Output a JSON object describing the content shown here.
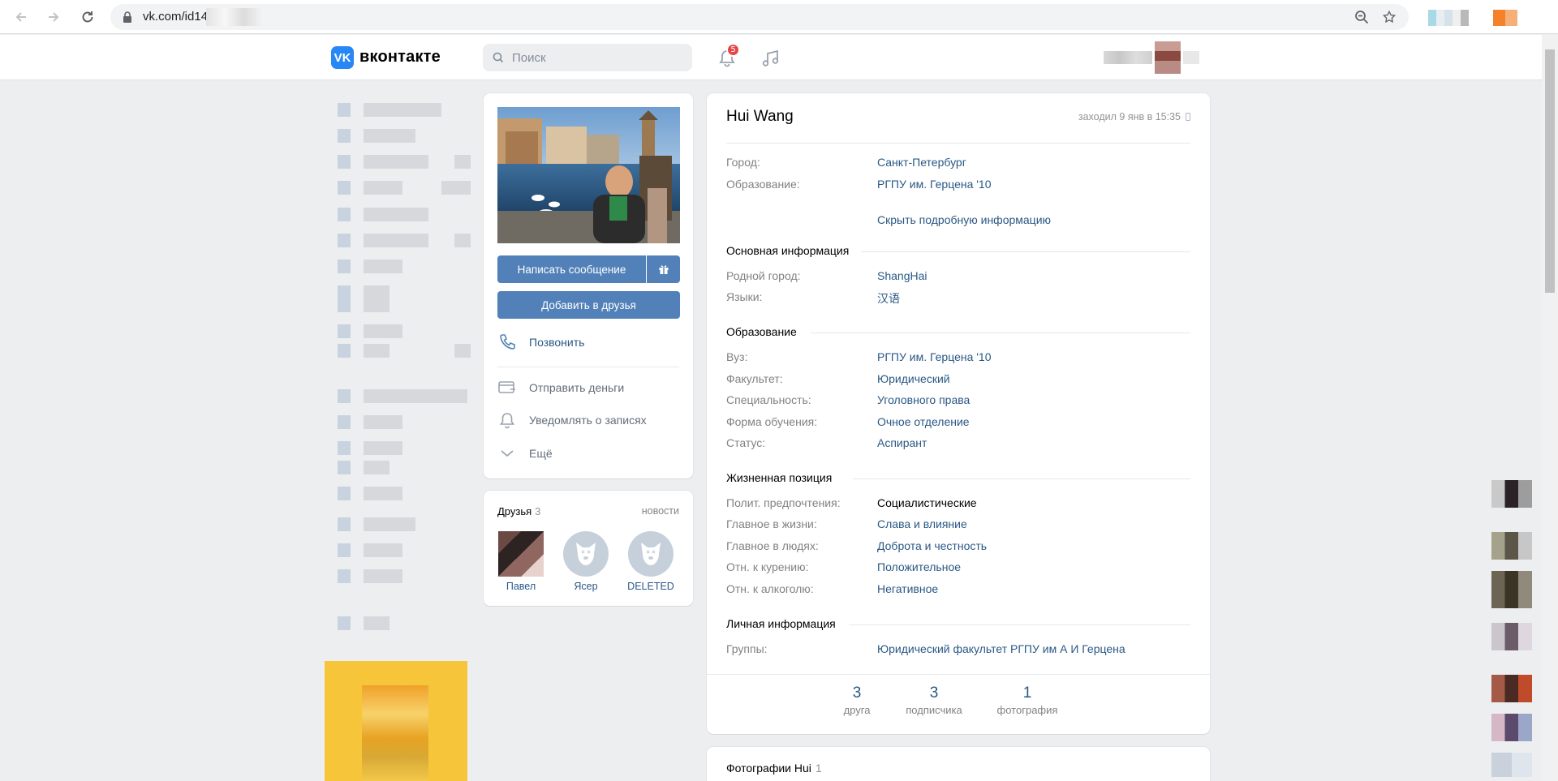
{
  "browser": {
    "url": "vk.com/id14",
    "back_icon": "arrow-left-icon",
    "forward_icon": "arrow-right-icon",
    "reload_icon": "reload-icon",
    "zoom_icon": "zoom-icon",
    "star_icon": "star-icon"
  },
  "header": {
    "logo_text": "вконтакте",
    "search_placeholder": "Поиск",
    "notification_count": "5"
  },
  "profile": {
    "name": "Hui Wang",
    "last_seen": "заходил 9 янв в 15:35",
    "buttons": {
      "message": "Написать сообщение",
      "add_friend": "Добавить в друзья"
    },
    "actions": {
      "call": "Позвонить",
      "send_money": "Отправить деньги",
      "notify": "Уведомлять о записях",
      "more": "Ещё"
    },
    "short_info": [
      {
        "key": "Город:",
        "value": "Санкт-Петербург"
      },
      {
        "key": "Образование:",
        "value": "РГПУ им. Герцена '10"
      }
    ],
    "toggle_details": "Скрыть подробную информацию",
    "sections": {
      "main": {
        "title": "Основная информация",
        "rows": [
          {
            "key": "Родной город:",
            "value": "ShangHai"
          },
          {
            "key": "Языки:",
            "value": "汉语"
          }
        ]
      },
      "education": {
        "title": "Образование",
        "rows": [
          {
            "key": "Вуз:",
            "value": "РГПУ им. Герцена '10"
          },
          {
            "key": "Факультет:",
            "value": "Юридический"
          },
          {
            "key": "Специальность:",
            "value": "Уголовного права"
          },
          {
            "key": "Форма обучения:",
            "value": "Очное отделение"
          },
          {
            "key": "Статус:",
            "value": "Аспирант"
          }
        ]
      },
      "life": {
        "title": "Жизненная позиция",
        "rows": [
          {
            "key": "Полит. предпочтения:",
            "value": "Социалистические"
          },
          {
            "key": "Главное в жизни:",
            "value": "Слава и влияние"
          },
          {
            "key": "Главное в людях:",
            "value": "Доброта и честность"
          },
          {
            "key": "Отн. к курению:",
            "value": "Положительное"
          },
          {
            "key": "Отн. к алкоголю:",
            "value": "Негативное"
          }
        ]
      },
      "personal": {
        "title": "Личная информация",
        "rows": [
          {
            "key": "Группы:",
            "value": "Юридический факультет РГПУ им А И Герцена"
          }
        ]
      }
    },
    "counters": [
      {
        "number": "3",
        "label": "друга"
      },
      {
        "number": "3",
        "label": "подписчика"
      },
      {
        "number": "1",
        "label": "фотография"
      }
    ],
    "photos": {
      "title": "Фотографии Hui",
      "count": "1"
    }
  },
  "friends": {
    "title": "Друзья",
    "count": "3",
    "link": "новости",
    "list": [
      {
        "name": "Павел"
      },
      {
        "name": "Ясер"
      },
      {
        "name": "DELETED"
      }
    ]
  },
  "colors": {
    "vk_blue": "#5181b8",
    "link": "#2a5885",
    "muted": "#828282",
    "page_bg": "#edeef0",
    "badge": "#e64646"
  }
}
